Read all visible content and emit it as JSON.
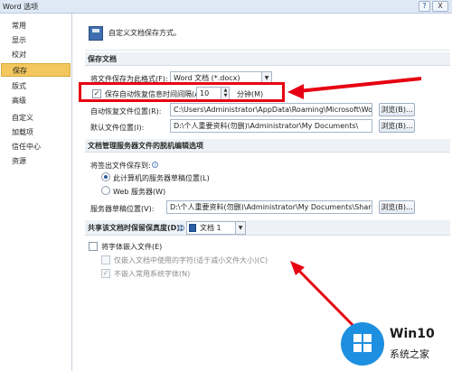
{
  "window": {
    "title": "Word 选项",
    "help_glyph": "?",
    "close_glyph": "X"
  },
  "sidebar": {
    "items": [
      {
        "label": "常用"
      },
      {
        "label": "显示"
      },
      {
        "label": "校对"
      },
      {
        "label": "保存",
        "active": true
      },
      {
        "label": "版式"
      },
      {
        "label": "高级"
      },
      {
        "label": "自定义"
      },
      {
        "label": "加载项"
      },
      {
        "label": "信任中心"
      },
      {
        "label": "资源"
      }
    ]
  },
  "header": {
    "text": "自定义文档保存方式。"
  },
  "save_docs": {
    "section_title": "保存文档",
    "format_label": "将文件保存为此格式(F):",
    "format_value": "Word 文档 (*.docx)",
    "autorecover_label": "保存自动恢复信息时间间隔(A)",
    "autorecover_checked": true,
    "autorecover_minutes": "10",
    "minutes_label": "分钟(M)",
    "autorecover_loc_label": "自动恢复文件位置(R):",
    "autorecover_loc_value": "C:\\Users\\Administrator\\AppData\\Roaming\\Microsoft\\Word\\",
    "default_loc_label": "默认文件位置(I):",
    "default_loc_value": "D:\\个人重要资料(勿删)\\Administrator\\My Documents\\",
    "browse_label": "浏览(B)..."
  },
  "offline": {
    "section_title": "文档管理服务器文件的脱机编辑选项",
    "checkout_label": "将签出文件保存到:",
    "option_server": "此计算机的服务器草稿位置(L)",
    "option_web": "Web 服务器(W)",
    "drafts_label": "服务器草稿位置(V):",
    "drafts_value": "D:\\个人重要资料(勿删)\\Administrator\\My Documents\\SharePoint 草稿\\",
    "browse_label": "浏览(B)..."
  },
  "fidelity": {
    "section_title": "共享该文档时保留保真度(D):",
    "doc_value": "文档 1",
    "embed_fonts_label": "将字体嵌入文件(E)",
    "embed_used_label": "仅嵌入文档中使用的字符(适于减小文件大小)(C)",
    "no_common_fonts_label": "不嵌入常用系统字体(N)"
  },
  "watermark": {
    "brand": "Win10",
    "sub": "系统之家"
  },
  "colors": {
    "highlight": "#e60012",
    "active_nav": "#f3c75d",
    "accent": "#2a5d9f"
  }
}
